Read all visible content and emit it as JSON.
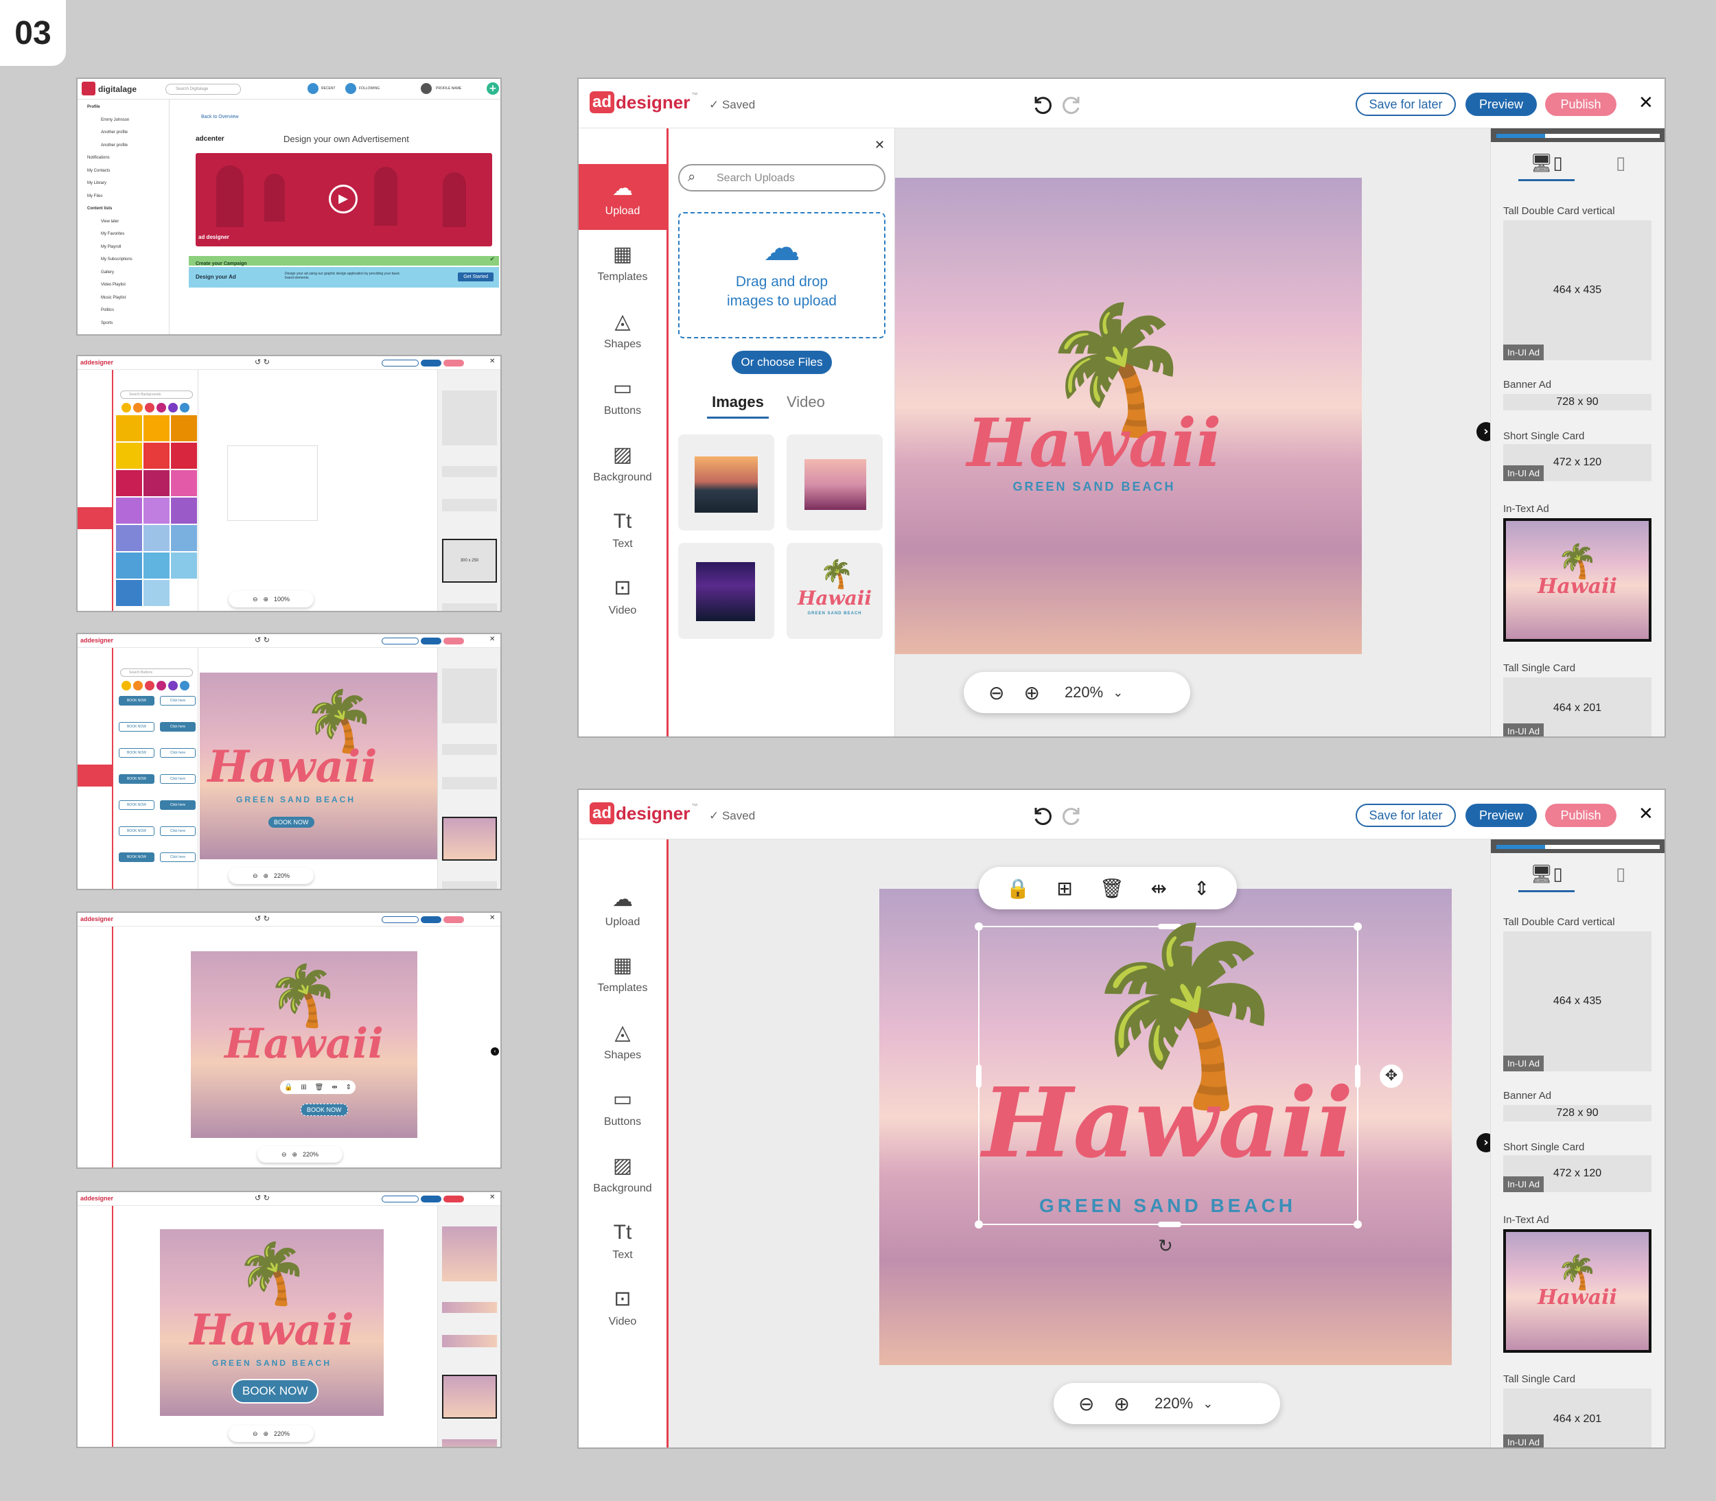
{
  "step_number": "03",
  "editor": {
    "logo_ad": "ad",
    "logo_designer": "designer",
    "logo_tm": "™",
    "saved": "✓ Saved",
    "save_for_later": "Save for later",
    "preview": "Preview",
    "publish": "Publish",
    "close": "✕",
    "tools": [
      "Upload",
      "Templates",
      "Shapes",
      "Buttons",
      "Background",
      "Text",
      "Video"
    ],
    "zoom": "220%",
    "upload_panel": {
      "search_placeholder": "Search Uploads",
      "drop_text_1": "Drag and drop",
      "drop_text_2": "images to upload",
      "choose_files": "Or choose Files",
      "tab_images": "Images",
      "tab_video": "Video"
    },
    "canvas": {
      "title": "Hawaii",
      "subtitle": "GREEN SAND BEACH"
    },
    "formats": [
      {
        "label": "Tall Double Card vertical",
        "size": "464 x 435",
        "tag": "In-UI Ad"
      },
      {
        "label": "Banner Ad",
        "size": "728 x 90"
      },
      {
        "label": "Short Single Card",
        "size": "472 x 120",
        "tag": "In-UI Ad"
      },
      {
        "label": "In-Text Ad"
      },
      {
        "label": "Tall Single Card",
        "size": "464 x 201",
        "tag": "In-UI Ad"
      }
    ]
  },
  "thumb1": {
    "brand": "digitalage",
    "search": "Search Digitalage",
    "recent": "RECENT",
    "following": "FOLLOWING",
    "profile_name": "PROFILE NAME",
    "sidebar": [
      "Profile",
      "Emmy Johnson",
      "Another profile",
      "Another profile",
      "Notifications",
      "My Contacts",
      "My Library",
      "My Files",
      "Content lists",
      "View later",
      "My Favorites",
      "My Playroll",
      "My Subscriptions",
      "Gallery",
      "Video Playlist",
      "Music Playlist",
      "Politics",
      "Sports"
    ],
    "back": "Back to Overview",
    "adcenter": "adcenter",
    "heading": "Design your own Advertisement",
    "create_campaign": "Create your Campaign",
    "design_ad": "Design your Ad",
    "design_desc": "Design your ad using our graphic design application by providing your basic brand elements.",
    "get_started": "Get Started"
  },
  "thumbs_small": {
    "zoom_100": "100%",
    "zoom_220": "220%",
    "book_now": "BOOK NOW",
    "click_here": "Click here",
    "search_bg": "Search Backgrounds",
    "search_btn": "Search Buttons",
    "in_text_size": "300 x 250"
  },
  "colors": {
    "brand_red": "#e4404f",
    "blue": "#1f67ad",
    "pink": "#ef7e93",
    "hawaii_pink": "#e85d72",
    "palm_blue": "#3a8fb8"
  }
}
